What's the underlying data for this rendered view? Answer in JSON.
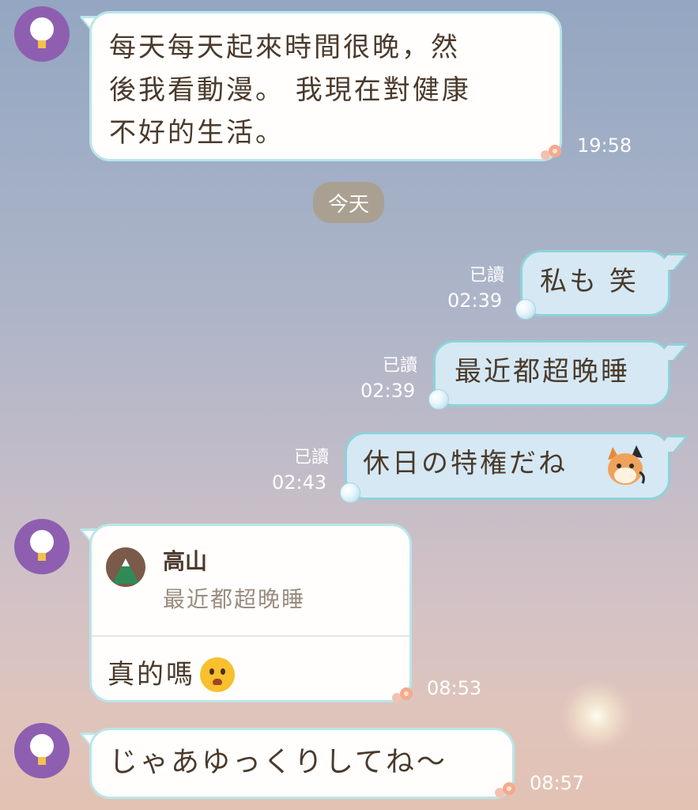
{
  "date_separator": "今天",
  "messages": [
    {
      "id": "m1",
      "direction": "in",
      "text": "每天每天起來時間很晚，然後我看動漫。 我現在對健康不好的生活。",
      "lines": [
        "每天每天起來時間很晚，然",
        "後我看動漫。 我現在對健康",
        "不好的生活。"
      ],
      "time": "19:58"
    },
    {
      "id": "m2",
      "direction": "out",
      "text": "私も 笑",
      "read": "已讀",
      "time": "02:39"
    },
    {
      "id": "m3",
      "direction": "out",
      "text": "最近都超晚睡",
      "read": "已讀",
      "time": "02:39"
    },
    {
      "id": "m4",
      "direction": "out",
      "text": "休日の特権だね",
      "sticker": "fox-emoji-icon",
      "read": "已讀",
      "time": "02:43"
    },
    {
      "id": "m5",
      "direction": "in",
      "reply": {
        "name": "高山",
        "text": "最近都超晚睡"
      },
      "text": "真的嗎",
      "emoji": "worried-face-emoji",
      "time": "08:53"
    },
    {
      "id": "m6",
      "direction": "in",
      "text": "じゃあゆっくりしてね〜",
      "time": "08:57"
    }
  ],
  "colors": {
    "avatar": "#8e5fb0",
    "bubble_in": "#fffefc",
    "bubble_out": "#d5e8f3",
    "bubble_border": "#b8e6ea",
    "text": "#4a3a2c",
    "date_pill": "#a9a092"
  }
}
